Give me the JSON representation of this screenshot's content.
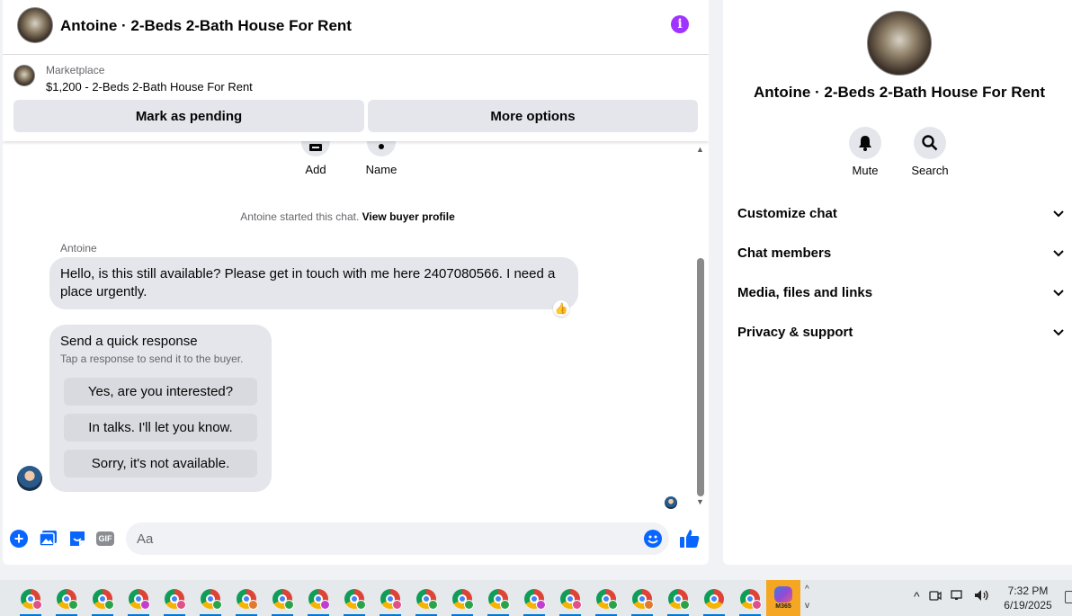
{
  "header": {
    "title": "Antoine · 2-Beds 2-Bath House For Rent",
    "info_icon": "info-icon",
    "info_glyph": "i"
  },
  "marketplace": {
    "label": "Marketplace",
    "item": "$1,200 - 2-Beds 2-Bath House For Rent",
    "pending_label": "Mark as pending",
    "more_label": "More options"
  },
  "top_actions": {
    "add_label": "Add",
    "name_label": "Name"
  },
  "chat": {
    "started_text": "Antoine started this chat.",
    "buyer_link": "View buyer profile",
    "sender": "Antoine",
    "message": "Hello, is this still available? Please get in touch with me here 2407080566. I need a place urgently.",
    "reaction": "👍",
    "quick": {
      "title": "Send a quick response",
      "subtitle": "Tap a response to send it to the buyer.",
      "responses": [
        "Yes, are you interested?",
        "In talks. I'll let you know.",
        "Sorry, it's not available."
      ]
    }
  },
  "composer": {
    "placeholder": "Aa",
    "gif_label": "GIF",
    "plus_glyph": "+"
  },
  "side": {
    "title": "Antoine · 2-Beds 2-Bath House For Rent",
    "mute_label": "Mute",
    "search_label": "Search",
    "sections": [
      "Customize chat",
      "Chat members",
      "Media, files and links",
      "Privacy & support"
    ]
  },
  "taskbar": {
    "m365_label": "M365",
    "time": "7:32 PM",
    "date": "6/19/2025",
    "up_glyph": "^",
    "scroll_glyphs": [
      "^",
      "v"
    ],
    "badge_colors": [
      "#e0508a",
      "#2aa34a",
      "#2aa34a",
      "#c03fd0",
      "#e0508a",
      "#2aa34a",
      "#e07a30",
      "#2aa34a",
      "#c03fd0",
      "#2aa34a",
      "#e0508a",
      "#2aa34a",
      "#2aa34a",
      "#2aa34a",
      "#c03fd0",
      "#e0508a",
      "#2aa34a",
      "#e07a30",
      "#2aa34a",
      "",
      "#e0508a"
    ]
  },
  "colors": {
    "accent": "#0866ff",
    "info": "#a033ff"
  }
}
